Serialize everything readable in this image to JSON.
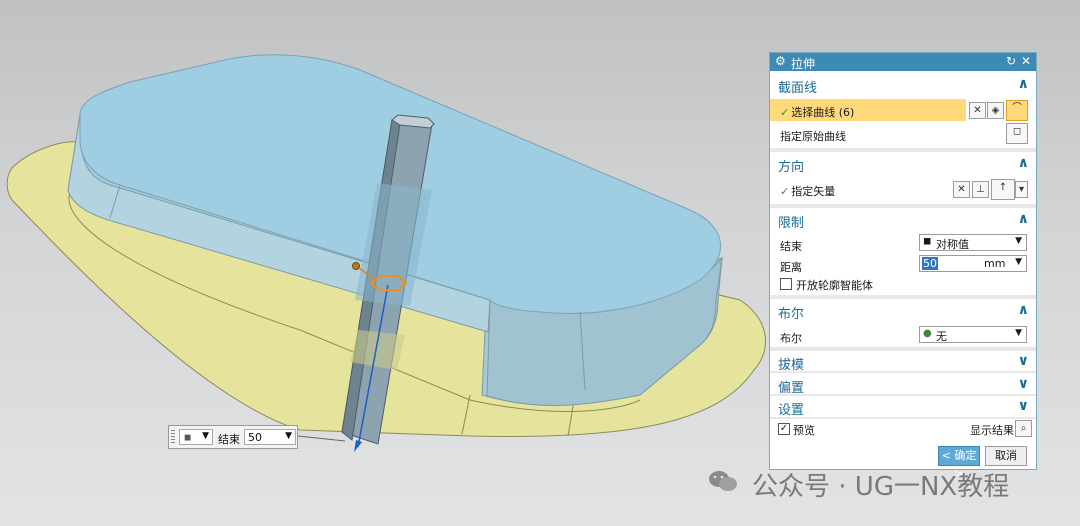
{
  "floating_input": {
    "label": "结束",
    "value": "50",
    "type_icon": "cube-icon"
  },
  "dialog": {
    "title": "拉伸",
    "section_curve": {
      "title": "截面线",
      "select_curve_label": "选择曲线 (6)",
      "specify_origin_label": "指定原始曲线"
    },
    "section_direction": {
      "title": "方向",
      "specify_vector_label": "指定矢量"
    },
    "section_limits": {
      "title": "限制",
      "end_label": "结束",
      "end_option": "对称值",
      "distance_label": "距离",
      "distance_value": "50",
      "distance_unit": "mm",
      "open_profile_label": "开放轮廓智能体"
    },
    "section_boolean": {
      "title": "布尔",
      "boolean_label": "布尔",
      "boolean_option": "无"
    },
    "section_draft": {
      "title": "拔模"
    },
    "section_offset": {
      "title": "偏置"
    },
    "section_settings": {
      "title": "设置"
    },
    "preview_label": "预览",
    "show_result_label": "显示结果",
    "ok_label": "< 确定 >",
    "cancel_label": "取消"
  },
  "watermark": {
    "text": "公众号 · UG一NX教程"
  },
  "colors": {
    "title_bar": "#3d8ab3",
    "section_text": "#1d6c97",
    "highlight_row": "#ffd97a",
    "solid_face": "#9ec8dc",
    "sketch_plane": "#e8e6a0",
    "ok_button": "#5ea9d6"
  }
}
